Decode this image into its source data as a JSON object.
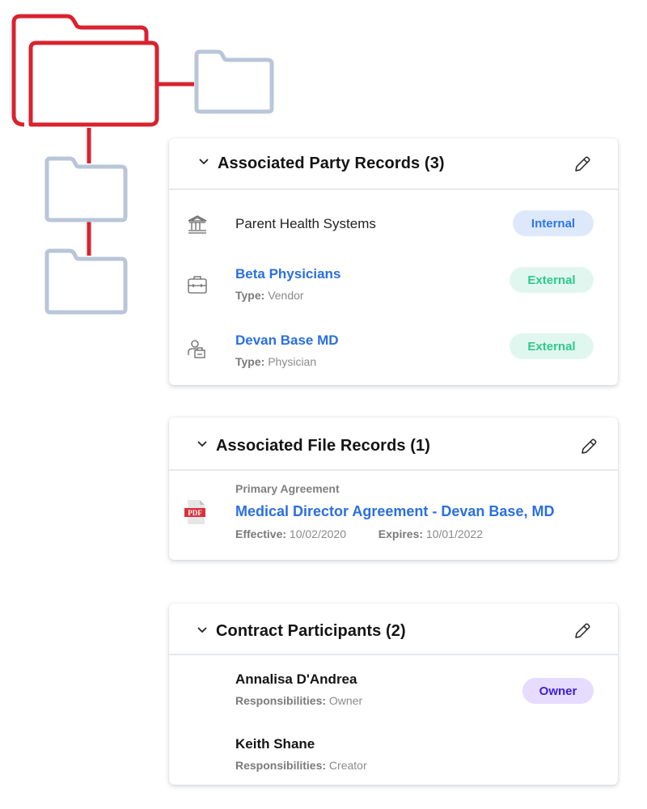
{
  "colors": {
    "accent_red": "#d9222e",
    "folder_gray": "#b8c6d8",
    "link_blue": "#2a6fe0",
    "internal_badge_bg": "#dde9fb",
    "external_badge_bg": "#e0f7ef",
    "owner_badge_bg": "#e5dcff"
  },
  "illustration": {
    "icons": [
      "folder-open-icon",
      "folder-icon",
      "folder-icon",
      "folder-icon"
    ]
  },
  "party_records": {
    "title": "Associated Party Records (3)",
    "items": [
      {
        "icon": "bank-icon",
        "name": "Parent Health Systems",
        "badge": "Internal"
      },
      {
        "icon": "briefcase-icon",
        "name": "Beta Physicians",
        "type_label": "Type:",
        "type_value": "Vendor",
        "badge": "External"
      },
      {
        "icon": "person-badge-icon",
        "name": "Devan Base MD",
        "type_label": "Type:",
        "type_value": "Physician",
        "badge": "External"
      }
    ]
  },
  "file_records": {
    "title": "Associated File Records (1)",
    "items": [
      {
        "icon": "pdf-file-icon",
        "icon_text": "PDF",
        "category": "Primary Agreement",
        "name": "Medical Director Agreement - Devan Base, MD",
        "effective_label": "Effective:",
        "effective_value": "10/02/2020",
        "expires_label": "Expires:",
        "expires_value": "10/01/2022"
      }
    ]
  },
  "participants": {
    "title": "Contract Participants (2)",
    "items": [
      {
        "name": "Annalisa D'Andrea",
        "resp_label": "Responsibilities:",
        "resp_value": "Owner",
        "badge": "Owner"
      },
      {
        "name": "Keith Shane",
        "resp_label": "Responsibilities:",
        "resp_value": "Creator"
      }
    ]
  }
}
